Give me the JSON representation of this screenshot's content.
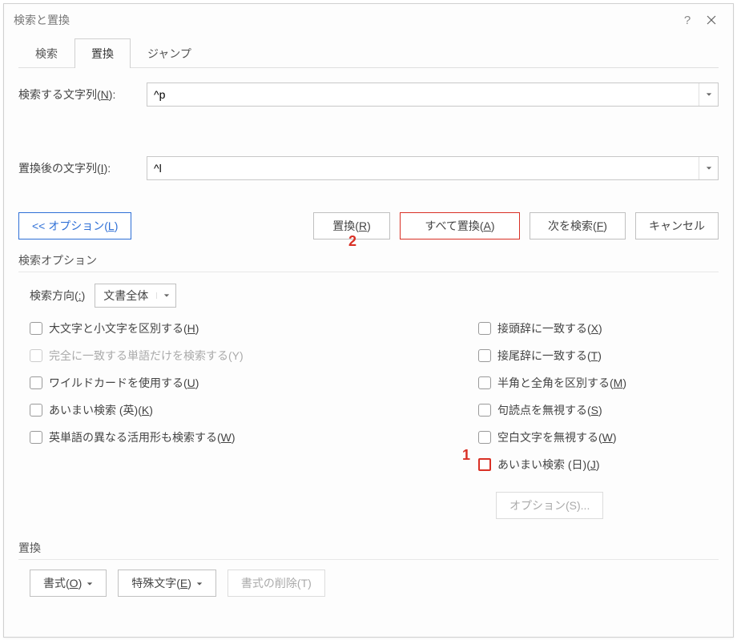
{
  "title": "検索と置換",
  "titlebar": {
    "help": "?",
    "close": "close"
  },
  "tabs": {
    "search": "検索",
    "replace": "置換",
    "jump": "ジャンプ"
  },
  "find": {
    "label_pre": "検索する文字列(",
    "label_u": "N",
    "label_post": "):",
    "value": "^p"
  },
  "replace": {
    "label_pre": "置換後の文字列(",
    "label_u": "I",
    "label_post": "):",
    "value": "^l"
  },
  "buttons": {
    "options_pre": "<< オプション(",
    "options_u": "L",
    "options_post": ")",
    "do_replace_pre": "置換(",
    "do_replace_u": "R",
    "do_replace_post": ")",
    "replace_all_pre": "すべて置換(",
    "replace_all_u": "A",
    "replace_all_post": ")",
    "find_next_pre": "次を検索(",
    "find_next_u": "F",
    "find_next_post": ")",
    "cancel": "キャンセル"
  },
  "markers": {
    "one": "1",
    "two": "2"
  },
  "section_search_options": "検索オプション",
  "direction": {
    "label_pre": "検索方向(",
    "label_u": ":",
    "label_post": ")",
    "value": "文書全体"
  },
  "checks_left": {
    "c0_pre": "大文字と小文字を区別する(",
    "c0_u": "H",
    "c0_post": ")",
    "c1": "完全に一致する単語だけを検索する(Y)",
    "c2_pre": "ワイルドカードを使用する(",
    "c2_u": "U",
    "c2_post": ")",
    "c3_pre": "あいまい検索 (英)(",
    "c3_u": "K",
    "c3_post": ")",
    "c4_pre": "英単語の異なる活用形も検索する(",
    "c4_u": "W",
    "c4_post": ")"
  },
  "checks_right": {
    "r0_pre": "接頭辞に一致する(",
    "r0_u": "X",
    "r0_post": ")",
    "r1_pre": "接尾辞に一致する(",
    "r1_u": "T",
    "r1_post": ")",
    "r2_pre": "半角と全角を区別する(",
    "r2_u": "M",
    "r2_post": ")",
    "r3_pre": "句読点を無視する(",
    "r3_u": "S",
    "r3_post": ")",
    "r4_pre": "空白文字を無視する(",
    "r4_u": "W",
    "r4_post": ")",
    "r5_pre": "あいまい検索 (日)(",
    "r5_u": "J",
    "r5_post": ")"
  },
  "options_btn": "オプション(S)...",
  "section_replace": "置換",
  "format_btn_pre": "書式(",
  "format_btn_u": "O",
  "format_btn_post": ")",
  "special_btn_pre": "特殊文字(",
  "special_btn_u": "E",
  "special_btn_post": ")",
  "noformat_btn": "書式の削除(T)"
}
